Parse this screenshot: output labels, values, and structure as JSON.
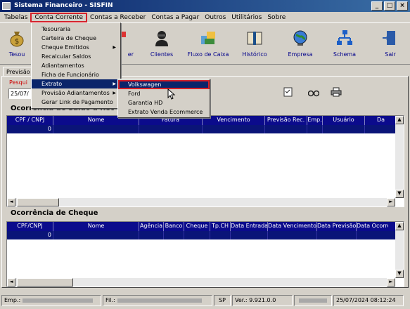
{
  "window": {
    "title": "Sistema Financeiro - SISFIN",
    "buttons": [
      "_",
      "□",
      "×"
    ]
  },
  "menubar": {
    "items": [
      "Tabelas",
      "Conta Corrente",
      "Contas a Receber",
      "Contas a Pagar",
      "Outros",
      "Utilitários",
      "Sobre"
    ]
  },
  "toolbar": {
    "items": [
      {
        "label": "Tesou",
        "icon": "money-bag-icon"
      },
      {
        "label": "er",
        "icon": "receive-icon"
      },
      {
        "label": "Clientes",
        "icon": "clients-icon"
      },
      {
        "label": "Fluxo de Caixa",
        "icon": "cash-flow-icon"
      },
      {
        "label": "Histórico",
        "icon": "history-book-icon"
      },
      {
        "label": "Empresa",
        "icon": "company-globe-icon"
      },
      {
        "label": "Schema",
        "icon": "schema-network-icon"
      },
      {
        "label": "Sair",
        "icon": "exit-door-icon"
      }
    ]
  },
  "tab": {
    "label": "Previsão"
  },
  "search": {
    "label": "Pesqui",
    "date": "25/07/"
  },
  "section1": {
    "title": "Ocorrência de Saldo a Rec",
    "columns": [
      "CPF / CNPJ",
      "Nome",
      "Fatura",
      "Vencimento",
      "Previsão Rec.",
      "Emp.",
      "Usuário",
      "Da"
    ],
    "row": [
      "0",
      "",
      "",
      "",
      "",
      "",
      "",
      ""
    ]
  },
  "section2": {
    "title": "Ocorrência de Cheque",
    "columns": [
      "CPF/CNPJ",
      "Nome",
      "Agência",
      "Banco",
      "Cheque",
      "Tp.CH",
      "Data Entrada",
      "Data Vencimento",
      "Data Previsão",
      "Data Ocorrê"
    ],
    "row": [
      "0",
      "",
      "",
      "",
      "",
      "",
      "",
      "",
      "",
      ""
    ]
  },
  "contaCorrenteMenu": {
    "items": [
      {
        "label": "Tesouraria",
        "submenu": false
      },
      {
        "label": "Carteira de Cheque",
        "submenu": false
      },
      {
        "label": "Cheque Emitidos",
        "submenu": true
      },
      {
        "label": "Recalcular Saldos",
        "submenu": false
      },
      {
        "label": "Adiantamentos",
        "submenu": false
      },
      {
        "label": "Ficha de Funcionário",
        "submenu": false
      },
      {
        "label": "Extrato",
        "submenu": true
      },
      {
        "label": "Provisão Adiantamentos",
        "submenu": true
      },
      {
        "label": "Gerar Link de Pagamento",
        "submenu": false
      }
    ]
  },
  "extratoSubmenu": {
    "items": [
      "Volkswagen",
      "Ford",
      "Garantia HD",
      "Extrato Venda Ecommerce"
    ]
  },
  "statusbar": {
    "emp": "Emp.:",
    "fil": "Fil.:",
    "uf": "SP",
    "version": "Ver.: 9.921.0.0",
    "datetime": "25/07/2024 08:12:24"
  },
  "colors": {
    "titlebar": "#0a246a",
    "highlight": "#0a246a",
    "annotation": "#d3212a",
    "gridHeader": "#0b0b8c"
  }
}
